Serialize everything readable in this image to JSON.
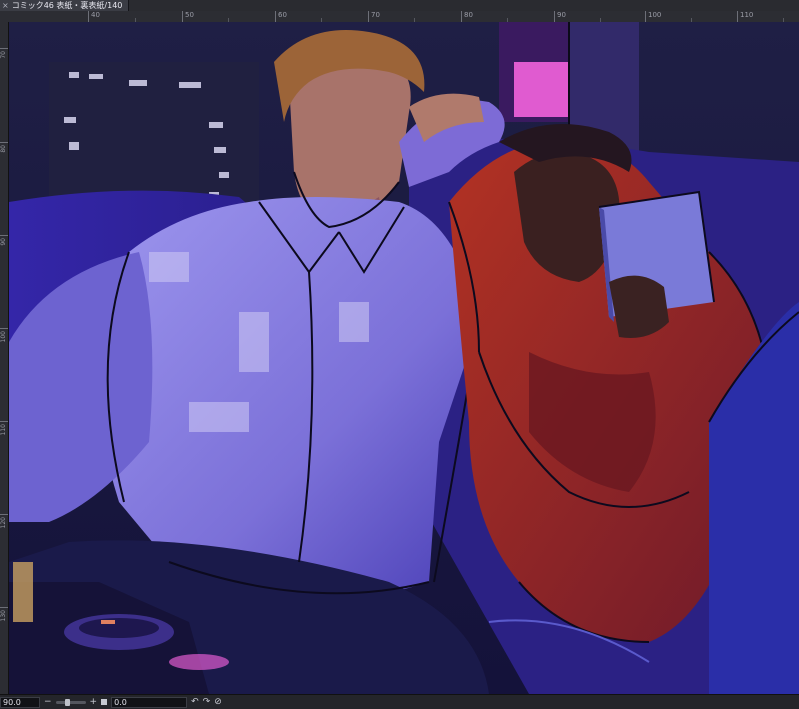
{
  "document": {
    "tab_close_glyph": "×",
    "tab_title": "コミック46 表紙・裏表紙/140"
  },
  "ruler_top": [
    "40",
    "50",
    "60",
    "70",
    "80",
    "90",
    "100",
    "110"
  ],
  "ruler_left": [
    "70",
    "80",
    "90",
    "100",
    "110",
    "120",
    "130"
  ],
  "statusbar": {
    "zoom_value": "90.0",
    "zoom_out_glyph": "−",
    "zoom_in_glyph": "+",
    "zoom_level": 0.35,
    "rotation_value": "0.0",
    "rotate_left_glyph": "↶",
    "rotate_right_glyph": "↷",
    "reset_rotation_glyph": "⊘"
  },
  "colors": {
    "window_bg": "#1a1a1e",
    "canvas_bg": "#20204a",
    "shirt": "#8f86e6",
    "hoodie": "#a3281f",
    "pink_light": "#e05bd0"
  }
}
